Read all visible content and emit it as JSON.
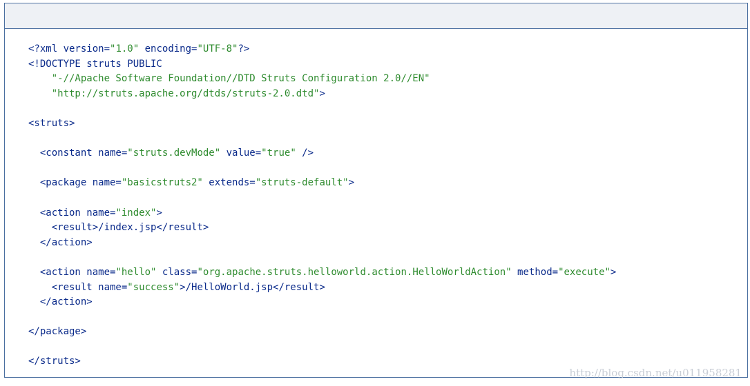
{
  "code_lines": [
    [
      {
        "t": "<?xml version=",
        "c": "tag"
      },
      {
        "t": "\"1.0\"",
        "c": "str"
      },
      {
        "t": " encoding=",
        "c": "tag"
      },
      {
        "t": "\"UTF-8\"",
        "c": "str"
      },
      {
        "t": "?>",
        "c": "tag"
      }
    ],
    [
      {
        "t": "<!DOCTYPE struts PUBLIC",
        "c": "tag"
      }
    ],
    [
      {
        "t": "    \"-//Apache Software Foundation//DTD Struts Configuration 2.0//EN\"",
        "c": "str"
      }
    ],
    [
      {
        "t": "    \"http://struts.apache.org/dtds/struts-2.0.dtd\"",
        "c": "str"
      },
      {
        "t": ">",
        "c": "tag"
      }
    ],
    [],
    [
      {
        "t": "<struts>",
        "c": "tag"
      }
    ],
    [],
    [
      {
        "t": "  <constant name=",
        "c": "tag"
      },
      {
        "t": "\"struts.devMode\"",
        "c": "str"
      },
      {
        "t": " value=",
        "c": "tag"
      },
      {
        "t": "\"true\"",
        "c": "str"
      },
      {
        "t": " />",
        "c": "tag"
      }
    ],
    [],
    [
      {
        "t": "  <package name=",
        "c": "tag"
      },
      {
        "t": "\"basicstruts2\"",
        "c": "str"
      },
      {
        "t": " extends=",
        "c": "tag"
      },
      {
        "t": "\"struts-default\"",
        "c": "str"
      },
      {
        "t": ">",
        "c": "tag"
      }
    ],
    [],
    [
      {
        "t": "  <action name=",
        "c": "tag"
      },
      {
        "t": "\"index\"",
        "c": "str"
      },
      {
        "t": ">",
        "c": "tag"
      }
    ],
    [
      {
        "t": "    <result>/index.jsp</result>",
        "c": "tag"
      }
    ],
    [
      {
        "t": "  </action>",
        "c": "tag"
      }
    ],
    [],
    [
      {
        "t": "  <action name=",
        "c": "tag"
      },
      {
        "t": "\"hello\"",
        "c": "str"
      },
      {
        "t": " class=",
        "c": "tag"
      },
      {
        "t": "\"org.apache.struts.helloworld.action.HelloWorldAction\"",
        "c": "str"
      },
      {
        "t": " method=",
        "c": "tag"
      },
      {
        "t": "\"execute\"",
        "c": "str"
      },
      {
        "t": ">",
        "c": "tag"
      }
    ],
    [
      {
        "t": "    <result name=",
        "c": "tag"
      },
      {
        "t": "\"success\"",
        "c": "str"
      },
      {
        "t": ">/HelloWorld.jsp</result>",
        "c": "tag"
      }
    ],
    [
      {
        "t": "  </action>",
        "c": "tag"
      }
    ],
    [],
    [
      {
        "t": "</package>",
        "c": "tag"
      }
    ],
    [],
    [
      {
        "t": "</struts>",
        "c": "tag"
      }
    ]
  ],
  "watermark": "http://blog.csdn.net/u011958281"
}
